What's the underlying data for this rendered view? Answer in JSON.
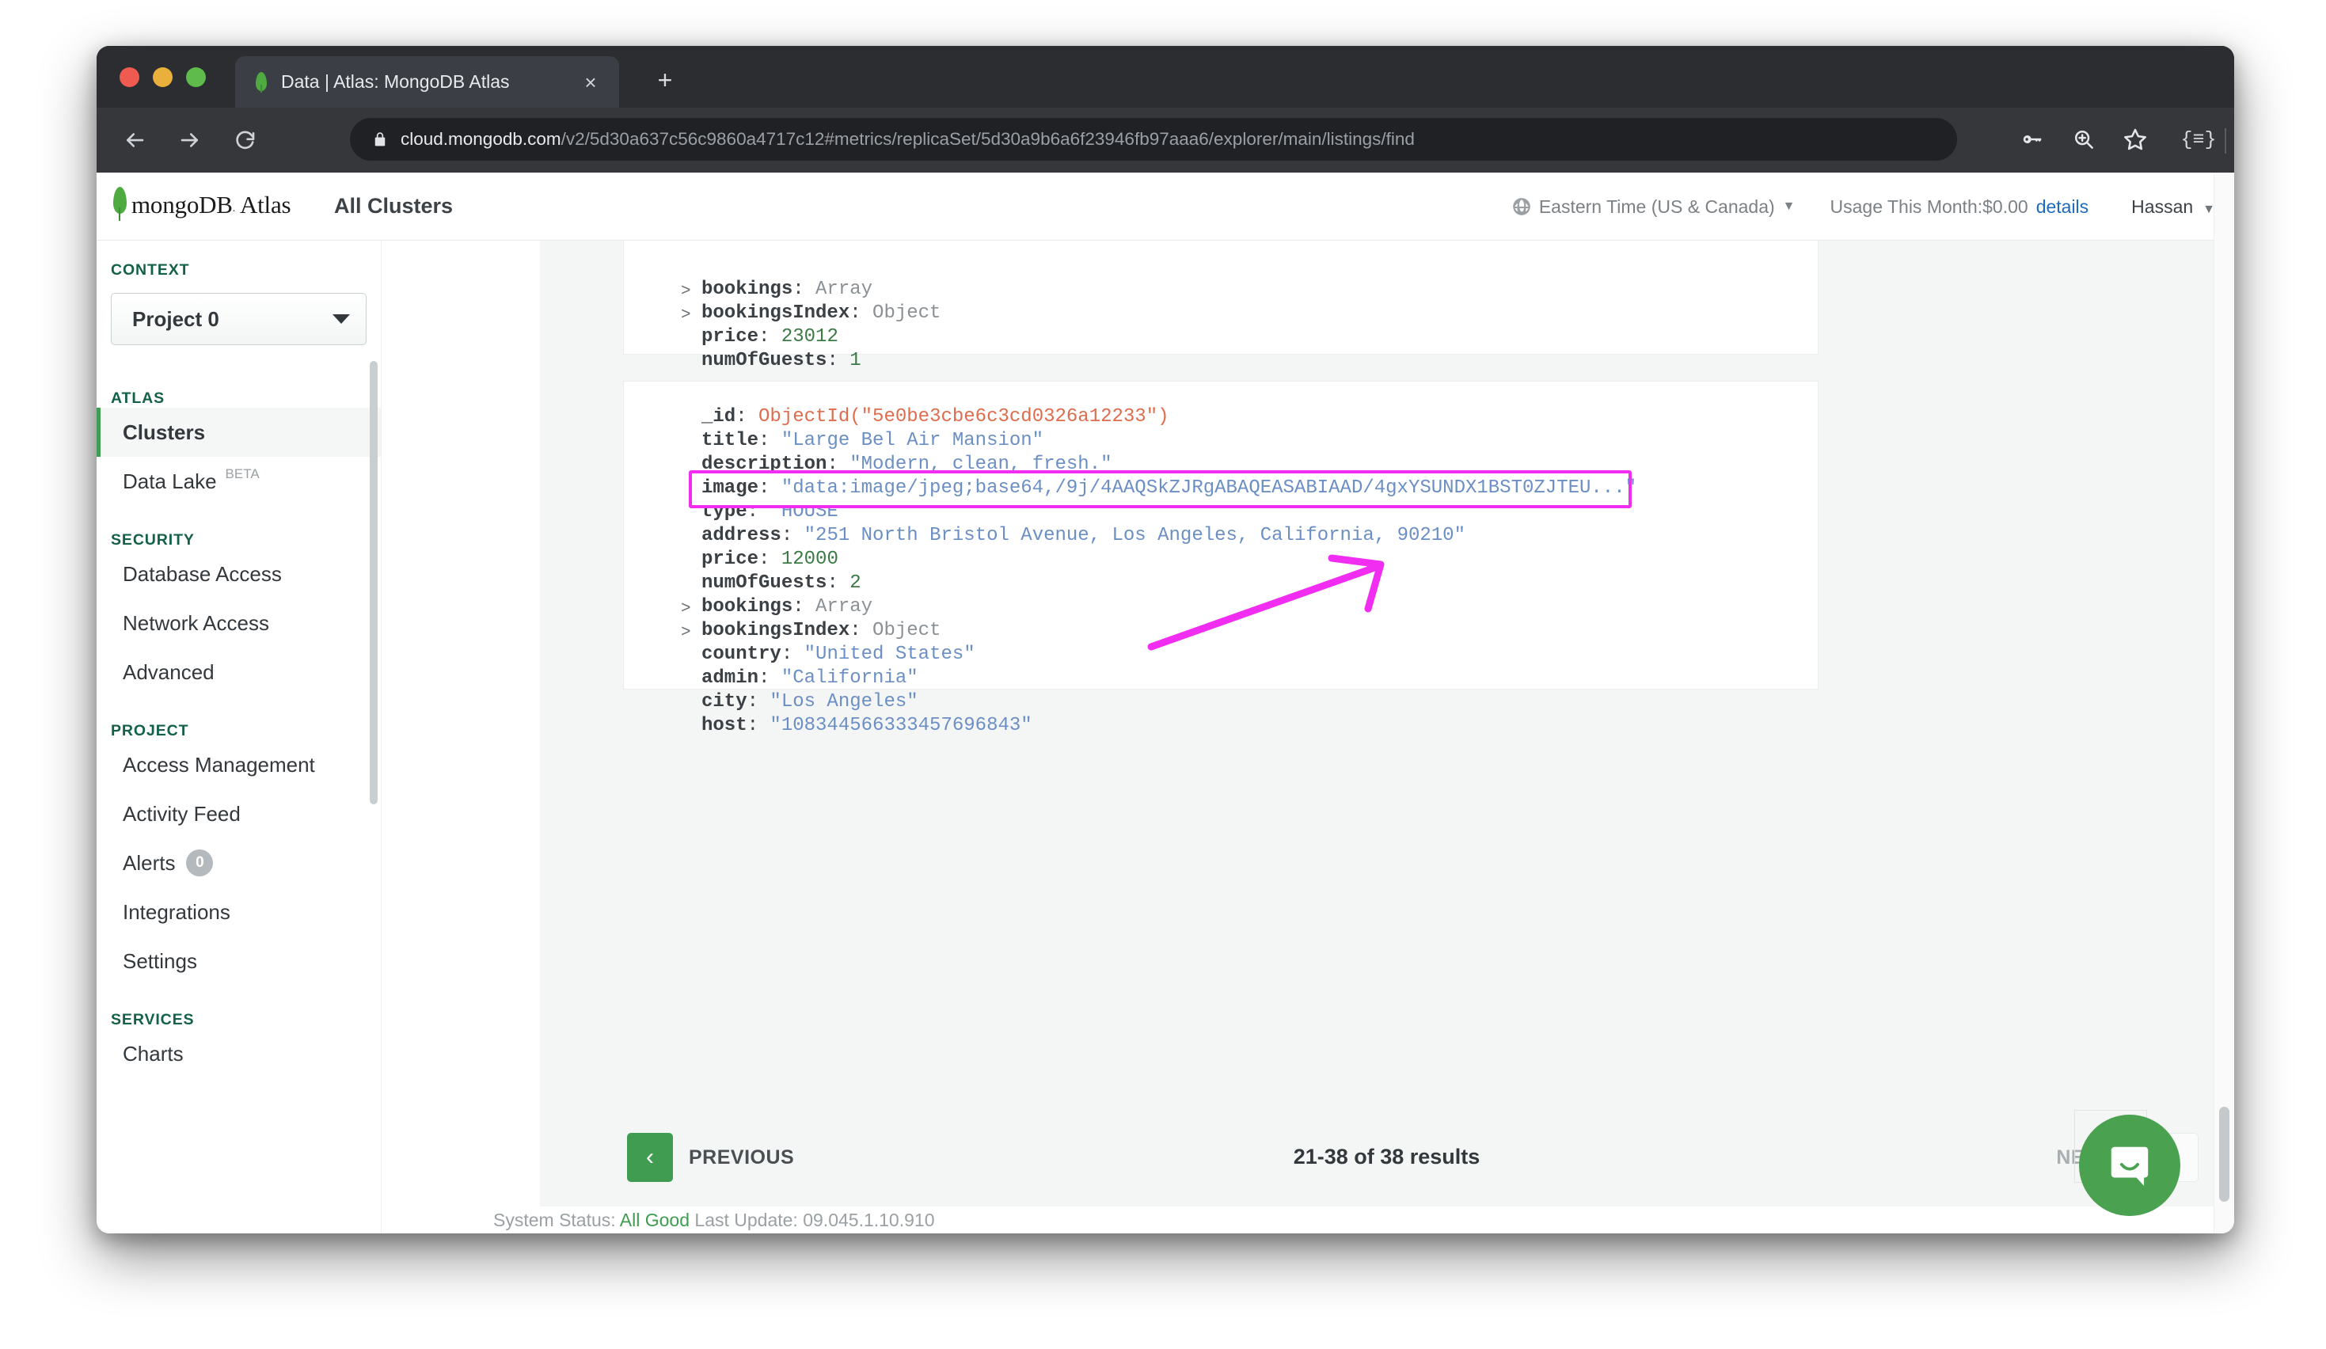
{
  "browser": {
    "tab": {
      "title": "Data | Atlas: MongoDB Atlas",
      "favicon": "mongodb-leaf-icon",
      "close": "×"
    },
    "new_tab": "+",
    "nav": {
      "back": "back-arrow-icon",
      "forward": "forward-arrow-icon",
      "reload": "reload-icon"
    },
    "omnibox": {
      "lock": "lock-icon",
      "url_host": "cloud.mongodb.com",
      "url_path": "/v2/5d30a637c56c9860a4717c12#metrics/replicaSet/5d30a9b6a6f23946fb97aaa6/explorer/main/listings/find"
    },
    "toolbar_icons": [
      "key-icon",
      "zoom-search-icon",
      "star-bookmark-icon",
      "json-viewer-icon",
      "profile-avatar",
      "kebab-menu-icon"
    ],
    "json_ext_glyph": "{≡}"
  },
  "header": {
    "logo_text": "mongoDB",
    "logo_reg": ".",
    "logo_atlas": "Atlas",
    "all_clusters": "All Clusters",
    "timezone": "Eastern Time (US & Canada)",
    "usage": "Usage This Month:$0.00",
    "usage_details": "details",
    "user": "Hassan"
  },
  "sidebar": {
    "context_label": "CONTEXT",
    "project": "Project 0",
    "atlas_label": "ATLAS",
    "atlas_items": [
      {
        "label": "Clusters",
        "active": true
      },
      {
        "label": "Data Lake",
        "badge": "BETA",
        "active": false
      }
    ],
    "security_label": "SECURITY",
    "security_items": [
      {
        "label": "Database Access"
      },
      {
        "label": "Network Access"
      },
      {
        "label": "Advanced"
      }
    ],
    "project_label": "PROJECT",
    "project_items": [
      {
        "label": "Access Management"
      },
      {
        "label": "Activity Feed"
      },
      {
        "label": "Alerts",
        "count": "0"
      },
      {
        "label": "Integrations"
      },
      {
        "label": "Settings"
      }
    ],
    "services_label": "SERVICES",
    "services_items": [
      {
        "label": "Charts"
      }
    ]
  },
  "documents": {
    "doc_previous_tail": [
      {
        "toggle": ">",
        "key": "bookings",
        "sep": ":",
        "type": "Array"
      },
      {
        "toggle": ">",
        "key": "bookingsIndex",
        "sep": ":",
        "type": "Object"
      },
      {
        "key": "price",
        "sep": ":",
        "num": "23012"
      },
      {
        "key": "numOfGuests",
        "sep": ":",
        "num": "1"
      }
    ],
    "doc_current": {
      "id_key": "_id",
      "id_value": "ObjectId(\"5e0be3cbe6c3cd0326a12233\")",
      "title_key": "title",
      "title_value": "\"Large Bel Air Mansion\"",
      "description_key": "description",
      "description_value": "\"Modern, clean, fresh.\"",
      "image_key": "image",
      "image_value": "\"data:image/jpeg;base64,/9j/4AAQSkZJRgABAQEASABIAAD/4gxYSUNDX1BST0ZJTEU...\"",
      "type_key": "type",
      "type_value": "\"HOUSE\"",
      "address_key": "address",
      "address_value": "\"251 North Bristol Avenue, Los Angeles, California, 90210\"",
      "price_key": "price",
      "price_value": "12000",
      "guests_key": "numOfGuests",
      "guests_value": "2",
      "bookings_key": "bookings",
      "bookings_type": "Array",
      "bookings_index_key": "bookingsIndex",
      "bookings_index_type": "Object",
      "country_key": "country",
      "country_value": "\"United States\"",
      "admin_key": "admin",
      "admin_value": "\"California\"",
      "city_key": "city",
      "city_value": "\"Los Angeles\"",
      "host_key": "host",
      "host_value": "\"108344566333457696843\"",
      "toggle_glyph": ">"
    }
  },
  "pagination": {
    "previous": "PREVIOUS",
    "results": "21-38 of 38 results",
    "next": "NEXT",
    "prev_arrow": "‹"
  },
  "footer": {
    "status_prefix": "System Status:",
    "status_value": "All Good",
    "build": "Last Update: 09.045.1.10.910"
  },
  "annotation": {
    "color": "#f02df0",
    "target": "image-field-row"
  },
  "intercom": {
    "label": "intercom-chat-icon"
  }
}
